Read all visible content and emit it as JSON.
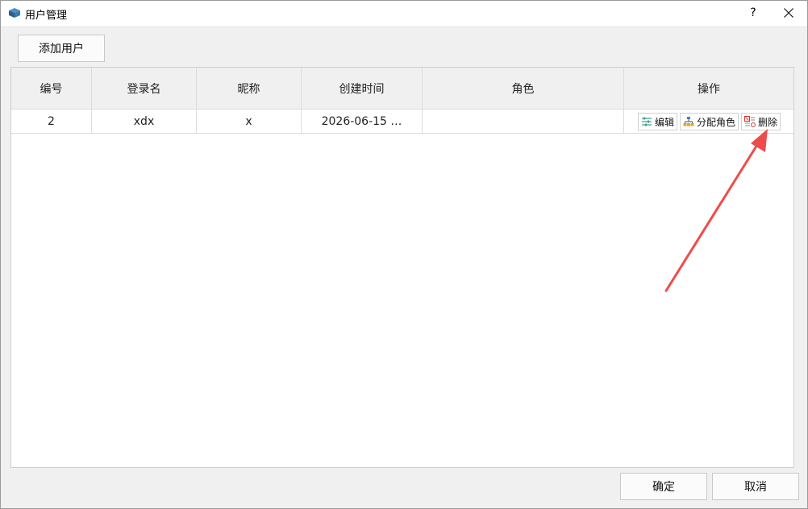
{
  "window": {
    "title": "用户管理",
    "help_label": "?",
    "icon": "app-cube-icon"
  },
  "toolbar": {
    "add_user_label": "添加用户"
  },
  "table": {
    "columns": [
      "编号",
      "登录名",
      "昵称",
      "创建时间",
      "角色",
      "操作"
    ],
    "rows": [
      {
        "id": "2",
        "login": "xdx",
        "nickname": "x",
        "created": "2026-06-15 …",
        "role": "",
        "actions": {
          "edit_label": "编辑",
          "assign_role_label": "分配角色",
          "delete_label": "删除"
        }
      }
    ]
  },
  "footer": {
    "ok_label": "确定",
    "cancel_label": "取消"
  },
  "annotation": {
    "arrow_color": "#f04b4b"
  }
}
